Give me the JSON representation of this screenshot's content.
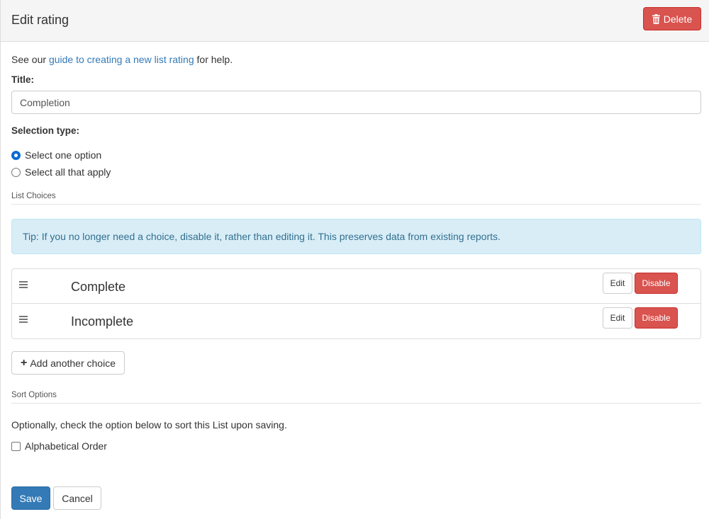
{
  "header": {
    "title": "Edit rating",
    "delete_label": "Delete"
  },
  "help": {
    "prefix": "See our ",
    "link_text": "guide to creating a new list rating",
    "suffix": " for help."
  },
  "form": {
    "title_label": "Title:",
    "title_value": "Completion",
    "selection_type_label": "Selection type:",
    "selection_options": [
      {
        "label": "Select one option",
        "checked": true
      },
      {
        "label": "Select all that apply",
        "checked": false
      }
    ]
  },
  "list_choices": {
    "legend": "List Choices",
    "tip": "Tip: If you no longer need a choice, disable it, rather than editing it. This preserves data from existing reports.",
    "items": [
      {
        "label": "Complete",
        "edit_label": "Edit",
        "disable_label": "Disable"
      },
      {
        "label": "Incomplete",
        "edit_label": "Edit",
        "disable_label": "Disable"
      }
    ],
    "add_label": "Add another choice"
  },
  "sort_options": {
    "legend": "Sort Options",
    "help": "Optionally, check the option below to sort this List upon saving.",
    "alphabetical_label": "Alphabetical Order",
    "alphabetical_checked": false
  },
  "footer": {
    "save_label": "Save",
    "cancel_label": "Cancel"
  },
  "colors": {
    "danger": "#d9534f",
    "primary": "#337ab7",
    "link": "#337ab7",
    "info_bg": "#d9edf7",
    "info_text": "#31708f"
  }
}
